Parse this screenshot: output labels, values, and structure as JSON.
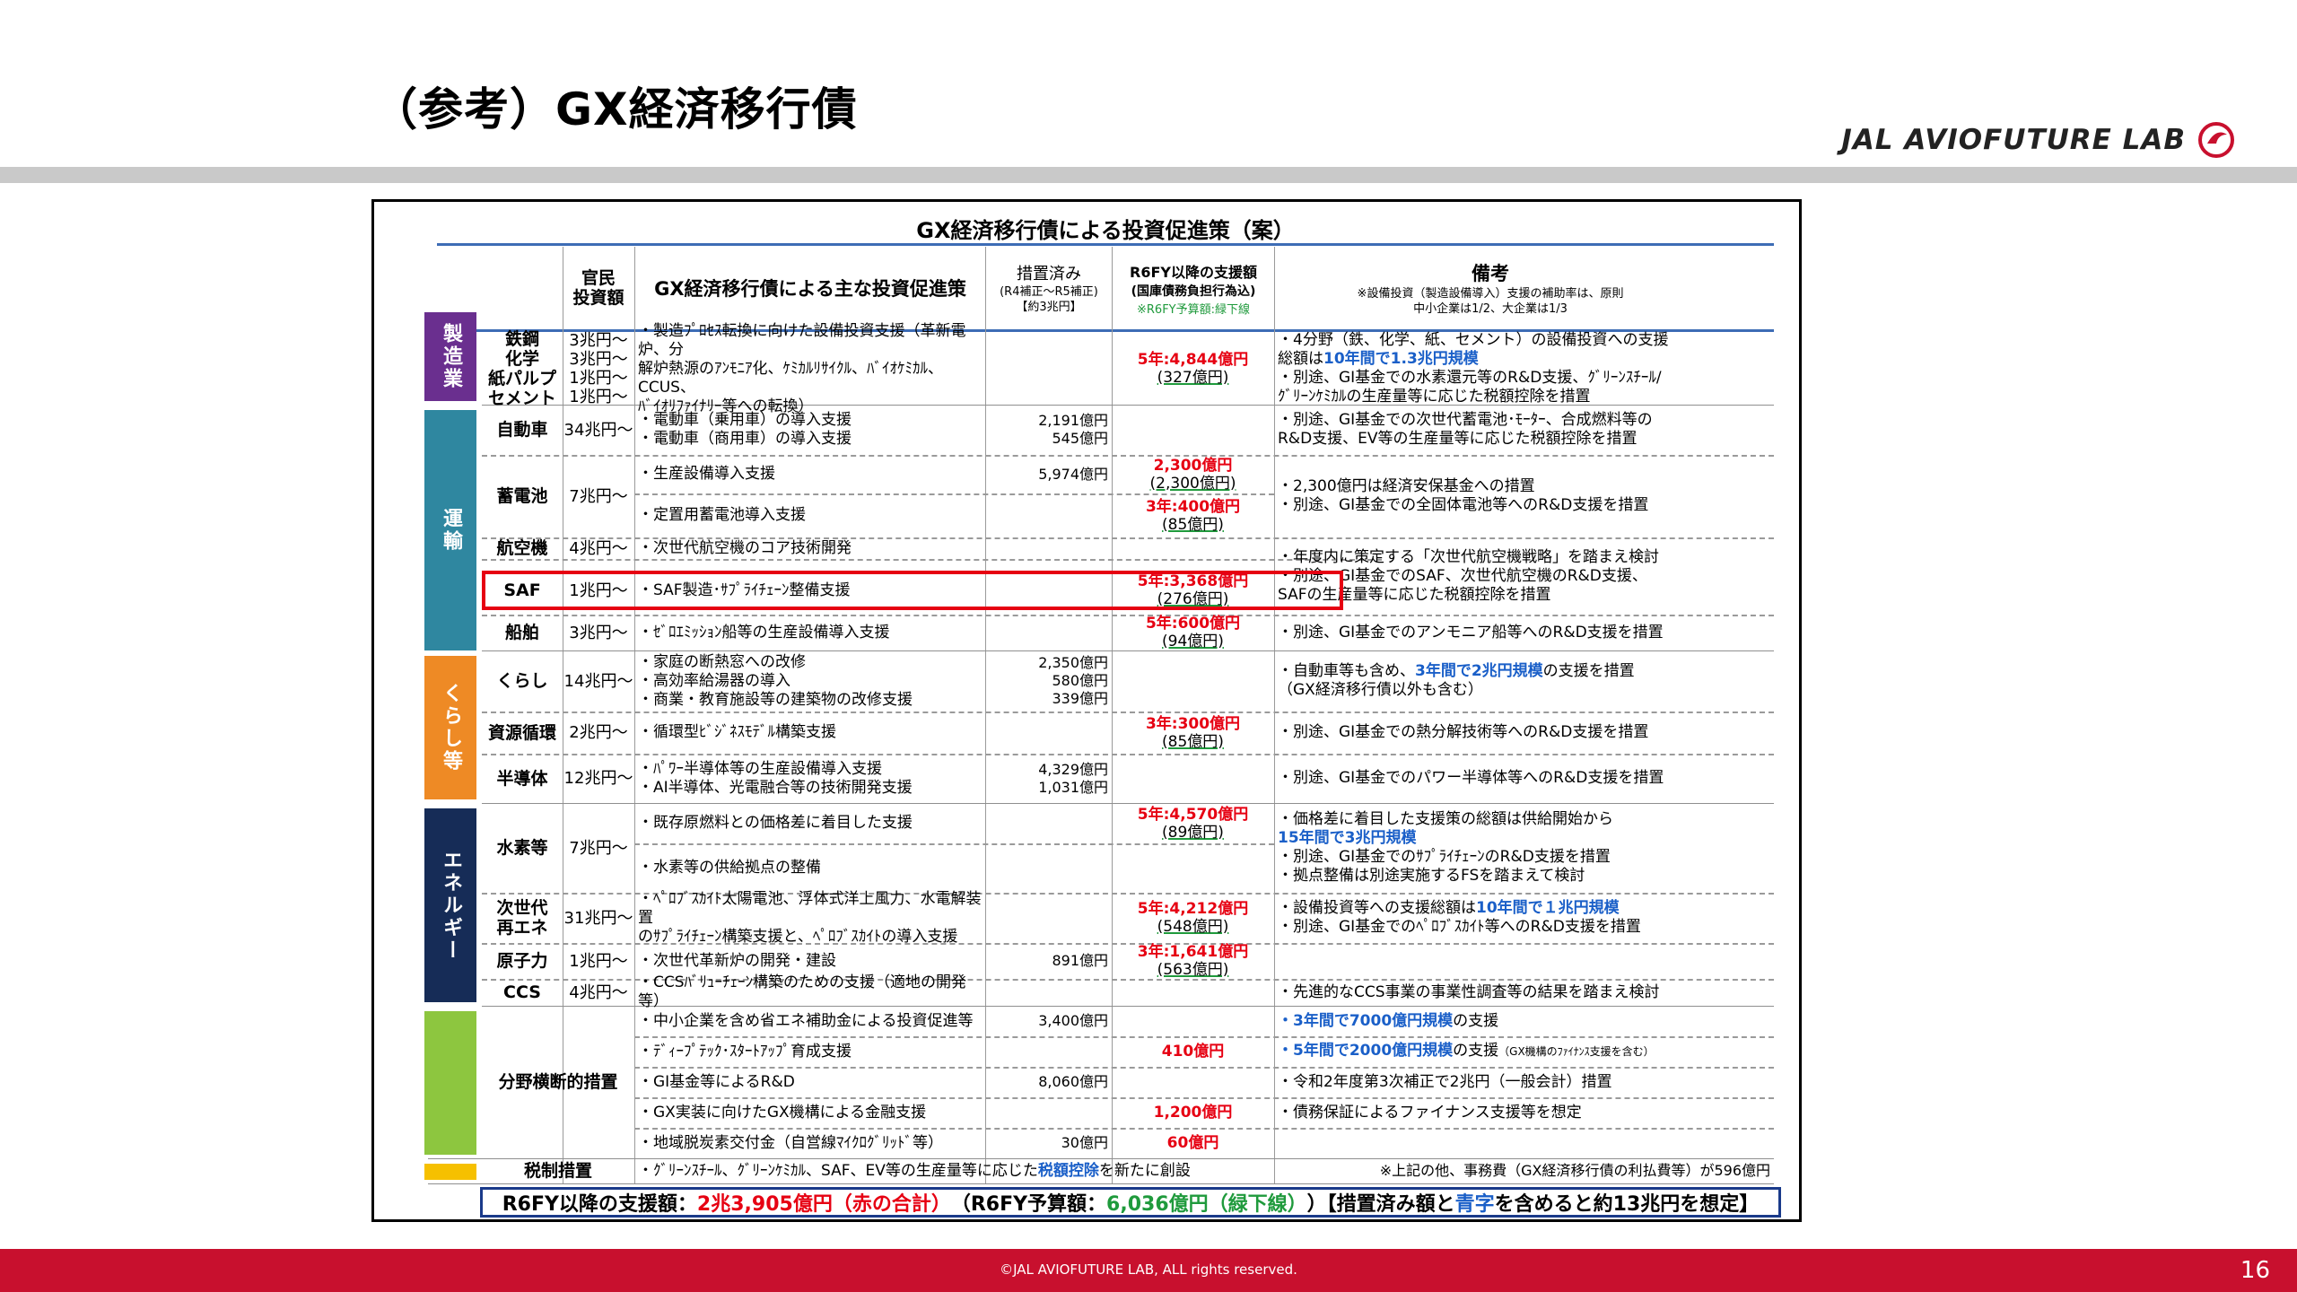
{
  "slide": {
    "title": "（参考）GX経済移行債",
    "logo_text": "JAL AVIOFUTURE LAB",
    "copyright": "©JAL AVIOFUTURE LAB, ALL rights reserved.",
    "page_number": "16"
  },
  "table": {
    "title": "GX経済移行債による投資促進策（案）",
    "headers": {
      "investment": "官民\n投資額",
      "measures": "GX経済移行債による主な投資促進策",
      "scheduled": "措置済み",
      "scheduled_sub": "(R4補正～R5補正)\n【約3兆円】",
      "r6": "R6FY以降の支援額",
      "r6_sub": "(国庫債務負担行為込)",
      "r6_green": "※R6FY予算額:緑下線",
      "remarks": "備考",
      "remarks_sub": "※設備投資（製造設備導入）支援の補助率は、原則\n中小企業は1/2、大企業は1/3"
    },
    "categories": {
      "mfg": "製造業",
      "transport": "運輸",
      "life": "くらし等",
      "energy": "エネルギー"
    },
    "rows": {
      "mfg": {
        "sub": "鉄鋼\n化学\n紙パルプ\nセメント",
        "amt": "3兆円～\n3兆円～\n1兆円～\n1兆円～",
        "pol": "・製造ﾌﾟﾛｾｽ転換に向けた設備投資支援（革新電炉、分\n  解炉熱源のｱﾝﾓﾆｱ化、ｹﾐｶﾙﾘｻｲｸﾙ、ﾊﾞｲｵｹﾐｶﾙ、CCUS、\n  ﾊﾞｲｵﾘﾌｧｲﾅﾘｰ等への転換）",
        "r6_red": "5年:4,844億円",
        "r6_grn": "(327億円)",
        "rem_a": "・4分野（鉄、化学、紙、セメント）の設備投資への支援\n  総額は",
        "rem_b": "10年間で1.3兆円規模",
        "rem_c": "\n・別途、GI基金での水素還元等のR&D支援、ｸﾞﾘｰﾝｽﾁｰﾙ/\n  ｸﾞﾘｰﾝｹﾐｶﾙの生産量等に応じた税額控除を措置"
      },
      "car": {
        "sub": "自動車",
        "amt": "34兆円～",
        "pol": "・電動車（乗用車）の導入支援\n・電動車（商用車）の導入支援",
        "sch": "2,191億円\n545億円",
        "rem": "・別途、GI基金での次世代蓄電池･ﾓｰﾀｰ、合成燃料等の\n  R&D支援、EV等の生産量等に応じた税額控除を措置"
      },
      "battery": {
        "sub": "蓄電池",
        "amt": "7兆円～",
        "pol1": "・生産設備導入支援",
        "sch1": "5,974億円",
        "r6_red1": "2,300億円",
        "r6_grn1": "(2,300億円)",
        "pol2": "・定置用蓄電池導入支援",
        "r6_red2": "3年:400億円",
        "r6_grn2": "(85億円)",
        "rem": "・2,300億円は経済安保基金への措置\n・別途、GI基金での全固体電池等へのR&D支援を措置"
      },
      "aircraft": {
        "sub": "航空機",
        "amt": "4兆円～",
        "pol": "・次世代航空機のコア技術開発",
        "rem": "・年度内に策定する「次世代航空機戦略」を踏まえ検討\n・別途、GI基金でのSAF、次世代航空機のR&D支援、\n  SAFの生産量等に応じた税額控除を措置"
      },
      "saf": {
        "sub": "SAF",
        "amt": "1兆円～",
        "pol": "・SAF製造･ｻﾌﾟﾗｲﾁｪｰﾝ整備支援",
        "r6_red": "5年:3,368億円",
        "r6_grn": "(276億円)"
      },
      "ship": {
        "sub": "船舶",
        "amt": "3兆円～",
        "pol": "・ｾﾞﾛｴﾐｯｼｮﾝ船等の生産設備導入支援",
        "r6_red": "5年:600億円",
        "r6_grn": "(94億円)",
        "rem": "・別途、GI基金でのアンモニア船等へのR&D支援を措置"
      },
      "living": {
        "sub": "くらし",
        "amt": "14兆円～",
        "pol": "・家庭の断熱窓への改修\n・高効率給湯器の導入\n・商業・教育施設等の建築物の改修支援",
        "sch": "2,350億円\n580億円\n339億円",
        "rem_a": "・自動車等も含め、",
        "rem_b": "3年間で2兆円規模",
        "rem_c": "の支援を措置\n  （GX経済移行債以外も含む）"
      },
      "recycle": {
        "sub": "資源循環",
        "amt": "2兆円～",
        "pol": "・循環型ﾋﾞｼﾞﾈｽﾓﾃﾞﾙ構築支援",
        "r6_red": "3年:300億円",
        "r6_grn": "(85億円)",
        "rem": "・別途、GI基金での熱分解技術等へのR&D支援を措置"
      },
      "semi": {
        "sub": "半導体",
        "amt": "12兆円～",
        "pol": "・ﾊﾟﾜｰ半導体等の生産設備導入支援\n・AI半導体、光電融合等の技術開発支援",
        "sch": "4,329億円\n1,031億円",
        "rem": "・別途、GI基金でのパワー半導体等へのR&D支援を措置"
      },
      "hydrogen": {
        "sub": "水素等",
        "amt": "7兆円～",
        "pol1": "・既存原燃料との価格差に着目した支援",
        "r6_red": "5年:4,570億円",
        "r6_grn": "(89億円)",
        "pol2": "・水素等の供給拠点の整備",
        "rem_a": "・価格差に着目した支援策の総額は供給開始から\n  ",
        "rem_b": "15年間で3兆円規模",
        "rem_c": "\n・別途、GI基金でのｻﾌﾟﾗｲﾁｪｰﾝのR&D支援を措置\n・拠点整備は別途実施するFSを踏まえて検討"
      },
      "renew": {
        "sub": "次世代\n再エネ",
        "amt": "31兆円～",
        "pol": "・ﾍﾟﾛﾌﾞｽｶｲﾄ太陽電池、浮体式洋上風力、水電解装置\n  のｻﾌﾟﾗｲﾁｪｰﾝ構築支援と、ﾍﾟﾛﾌﾞｽｶｲﾄの導入支援",
        "r6_red": "5年:4,212億円",
        "r6_grn": "(548億円)",
        "rem_a": "・設備投資等への支援総額は",
        "rem_b": "10年間で１兆円規模",
        "rem_c": "\n・別途、GI基金でのﾍﾟﾛﾌﾞｽｶｲﾄ等へのR&D支援を措置"
      },
      "nuclear": {
        "sub": "原子力",
        "amt": "1兆円～",
        "pol": "・次世代革新炉の開発・建設",
        "sch": "891億円",
        "r6_red": "3年:1,641億円",
        "r6_grn": "(563億円)"
      },
      "ccs": {
        "sub": "CCS",
        "amt": "4兆円～",
        "pol": "・CCSﾊﾞﾘｭｰﾁｪｰﾝ構築のための支援（適地の開発等）",
        "rem": "・先進的なCCS事業の事業性調査等の結果を踏まえ検討"
      },
      "cross": {
        "sub": "分野横断的措置",
        "r1": {
          "pol": "・中小企業を含め省エネ補助金による投資促進等",
          "sch": "3,400億円",
          "rem_b": "・3年間で7000億円規模",
          "rem_c": "の支援"
        },
        "r2": {
          "pol": "・ﾃﾞｨｰﾌﾟﾃｯｸ･ｽﾀｰﾄｱｯﾌﾟ育成支援",
          "r6_red": "410億円",
          "rem_b": "・5年間で2000億円規模",
          "rem_c": "の支援",
          "rem_small": "（GX機構のﾌｧｲﾅﾝｽ支援を含む）"
        },
        "r3": {
          "pol": "・GI基金等によるR&D",
          "sch": "8,060億円",
          "rem": "・令和2年度第3次補正で2兆円（一般会計）措置"
        },
        "r4": {
          "pol": "・GX実装に向けたGX機構による金融支援",
          "r6_red": "1,200億円",
          "rem": "・債務保証によるファイナンス支援等を想定"
        },
        "r5": {
          "pol": "・地域脱炭素交付金（自営線ﾏｲｸﾛｸﾞﾘｯﾄﾞ等）",
          "sch": "30億円",
          "r6_red": "60億円"
        }
      },
      "tax": {
        "sub": "税制措置",
        "pol_a": "・ｸﾞﾘｰﾝｽﾁｰﾙ、ｸﾞﾘｰﾝｹﾐｶﾙ、SAF、EV等の生産量等に応じた",
        "pol_b": "税額控除",
        "pol_c": "を新たに創設",
        "note": "※上記の他、事務費（GX経済移行債の利払費等）が596億円"
      }
    },
    "footer": {
      "a": "R6FY以降の支援額：",
      "b": "2兆3,905億円（赤の合計）",
      "c": "（R6FY予算額：",
      "d": "6,036億円（緑下線）",
      "e": "）【措置済み額と",
      "f": "青字",
      "g": "を含めると約13兆円を想定】"
    }
  },
  "colors": {
    "mfg": "#6a2f8f",
    "transport": "#2f87a0",
    "life": "#ee8a25",
    "energy": "#162c57",
    "cross": "#8dc63f",
    "tax": "#f6c000",
    "accent_red": "#c8102e"
  }
}
